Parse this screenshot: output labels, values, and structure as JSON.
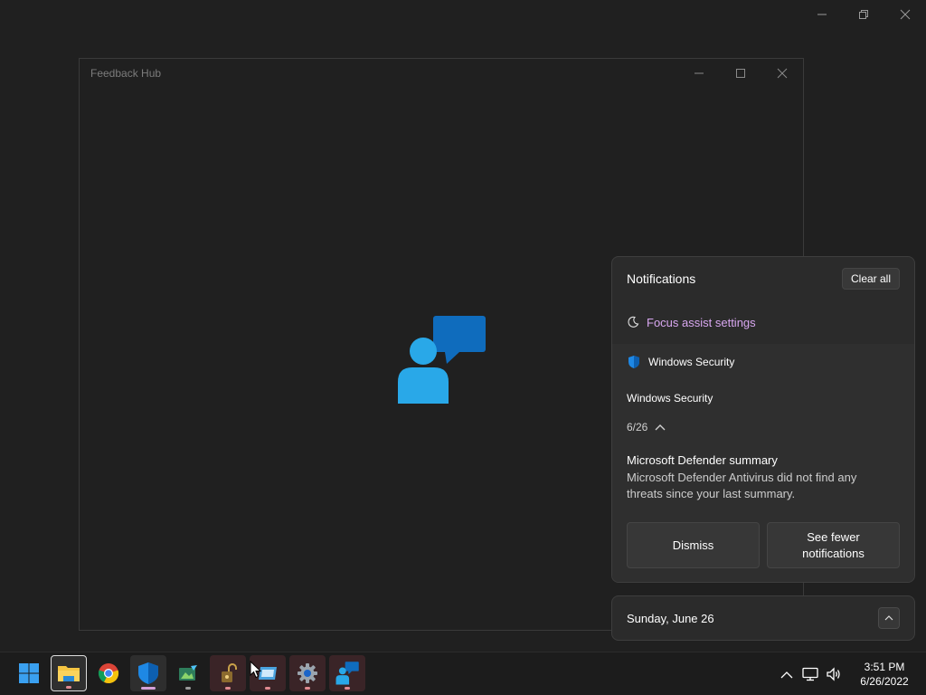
{
  "background_window": {
    "controls": [
      "minimize",
      "restore",
      "close"
    ]
  },
  "feedback_hub": {
    "title": "Feedback Hub",
    "splash_icon": "feedback-hub-logo"
  },
  "notifications": {
    "title": "Notifications",
    "clear_all_label": "Clear all",
    "focus_assist_label": "Focus assist settings",
    "focus_assist_icon": "moon-icon",
    "card": {
      "app_name": "Windows Security",
      "app_icon": "shield-icon",
      "group_title": "Windows Security",
      "date": "6/26",
      "heading": "Microsoft Defender summary",
      "body": "Microsoft Defender Antivirus did not find any threats since your last summary.",
      "dismiss_label": "Dismiss",
      "see_fewer_label": "See fewer notifications"
    }
  },
  "calendar": {
    "date_label": "Sunday, June 26"
  },
  "taskbar": {
    "apps": [
      {
        "name": "start",
        "icon": "windows-logo-icon"
      },
      {
        "name": "file-explorer",
        "icon": "folder-icon"
      },
      {
        "name": "chrome",
        "icon": "chrome-icon"
      },
      {
        "name": "windows-security",
        "icon": "shield-icon"
      },
      {
        "name": "image-editor",
        "icon": "image-icon"
      },
      {
        "name": "lock-app",
        "icon": "lock-icon"
      },
      {
        "name": "tablet-app",
        "icon": "tablet-icon"
      },
      {
        "name": "settings",
        "icon": "gear-icon"
      },
      {
        "name": "feedback-hub",
        "icon": "feedback-icon"
      }
    ],
    "clock": {
      "time": "3:51 PM",
      "date": "6/26/2022"
    }
  },
  "colors": {
    "accent": "#0f6cbd",
    "focus_link": "#d8a7f0",
    "panel_bg": "#2b2b2b",
    "desktop_bg": "#202020"
  }
}
